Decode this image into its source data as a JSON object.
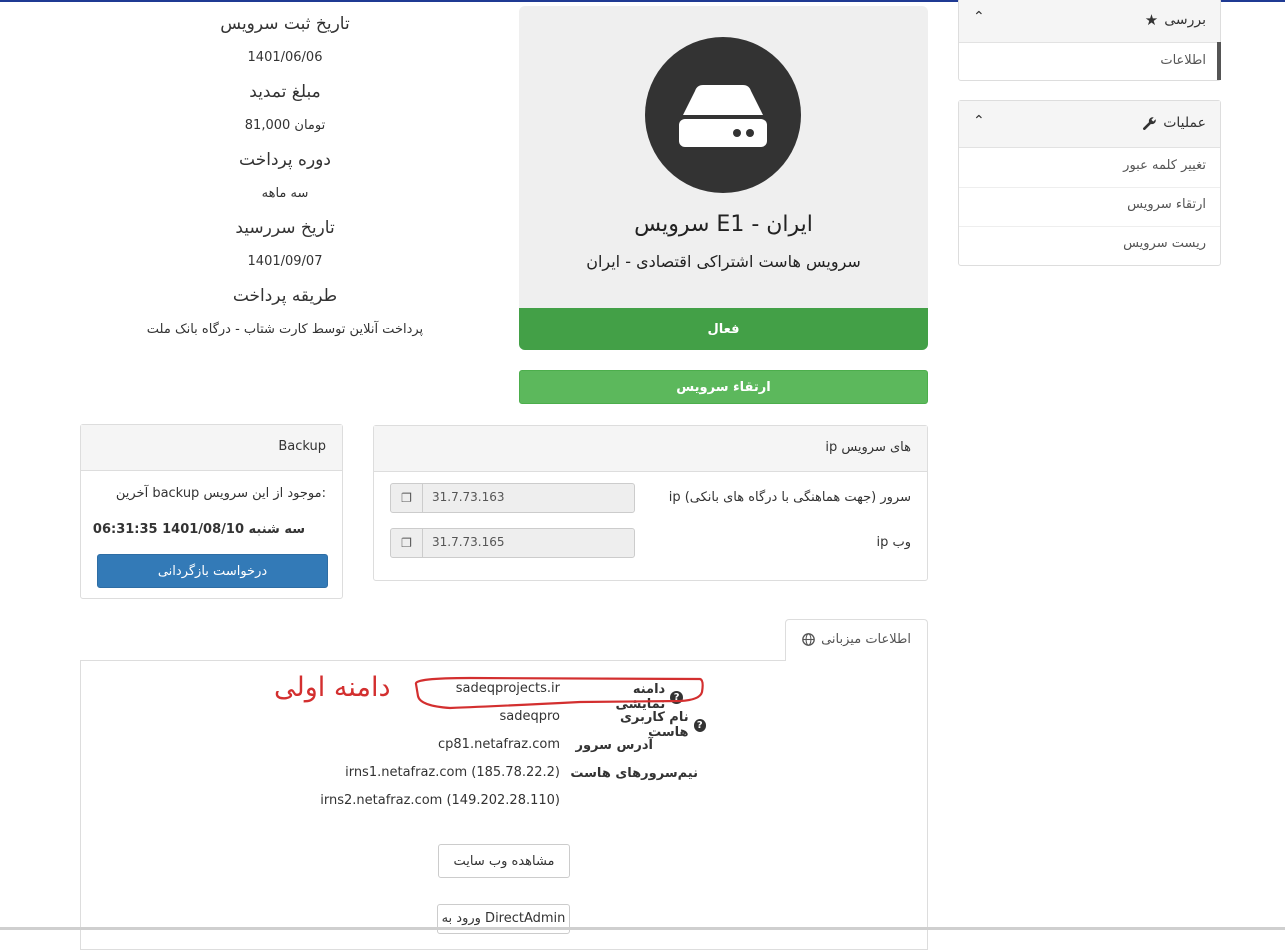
{
  "sidebar": {
    "overview": {
      "title": "بررسی",
      "items": [
        {
          "label": "اطلاعات"
        }
      ]
    },
    "actions": {
      "title": "عملیات",
      "items": [
        {
          "label": "تغییر کلمه عبور"
        },
        {
          "label": "ارتقاء سرویس"
        },
        {
          "label": "ریست سرویس"
        }
      ]
    }
  },
  "service": {
    "title": "سرویس E1 - ایران",
    "subtitle": "سرویس هاست اشتراکی اقتصادی - ایران",
    "status": "فعال",
    "upgrade_button": "ارتقاء سرویس"
  },
  "info": [
    {
      "label": "تاریخ ثبت سرویس",
      "value": "1401/06/06"
    },
    {
      "label": "مبلغ تمدید",
      "value": "81,000 تومان"
    },
    {
      "label": "دوره پرداخت",
      "value": "سه ماهه"
    },
    {
      "label": "تاریخ سررسید",
      "value": "1401/09/07"
    },
    {
      "label": "طریقه پرداخت",
      "value": "پرداخت آنلاین توسط کارت شتاب - درگاه بانک ملت"
    }
  ],
  "ips": {
    "title": "ip های سرویس",
    "rows": [
      {
        "label": "ip سرور (جهت هماهنگی با درگاه های بانکی)",
        "value": "31.7.73.163"
      },
      {
        "label": "ip وب",
        "value": "31.7.73.165"
      }
    ]
  },
  "backup": {
    "title": "Backup",
    "text": "آخرین backup موجود از این سرویس:",
    "datetime": "سه شنبه 1401/08/10 06:31:35",
    "button": "درخواست بازگردانی"
  },
  "hosting": {
    "tab_label": "اطلاعات میزبانی",
    "rows": [
      {
        "label": "دامنه نمایشی",
        "help": true,
        "value": "sadeqprojects.ir"
      },
      {
        "label": "نام کاربری هاست",
        "help": true,
        "value": "sadeqpro"
      },
      {
        "label": "آدرس سرور",
        "help": false,
        "value": "cp81.netafraz.com"
      },
      {
        "label": "نیم‌سرورهای هاست",
        "help": false,
        "value": "irns1.netafraz.com (185.78.22.2)"
      }
    ],
    "extra_ns": "irns2.netafraz.com (149.202.28.110)",
    "visit_button": "مشاهده وب سایت",
    "login_button": "ورود به DirectAdmin"
  },
  "annotation": "دامنه اولی",
  "colors": {
    "success": "#43a047",
    "success_light": "#5cb85c",
    "primary": "#337ab7",
    "annotation": "#d32f2f"
  },
  "icons": {
    "overview": "star-icon",
    "actions": "wrench-icon",
    "collapse": "chevron-up-icon",
    "copy": "copy-icon",
    "globe": "globe-icon",
    "help": "question-icon",
    "service": "server-icon"
  }
}
